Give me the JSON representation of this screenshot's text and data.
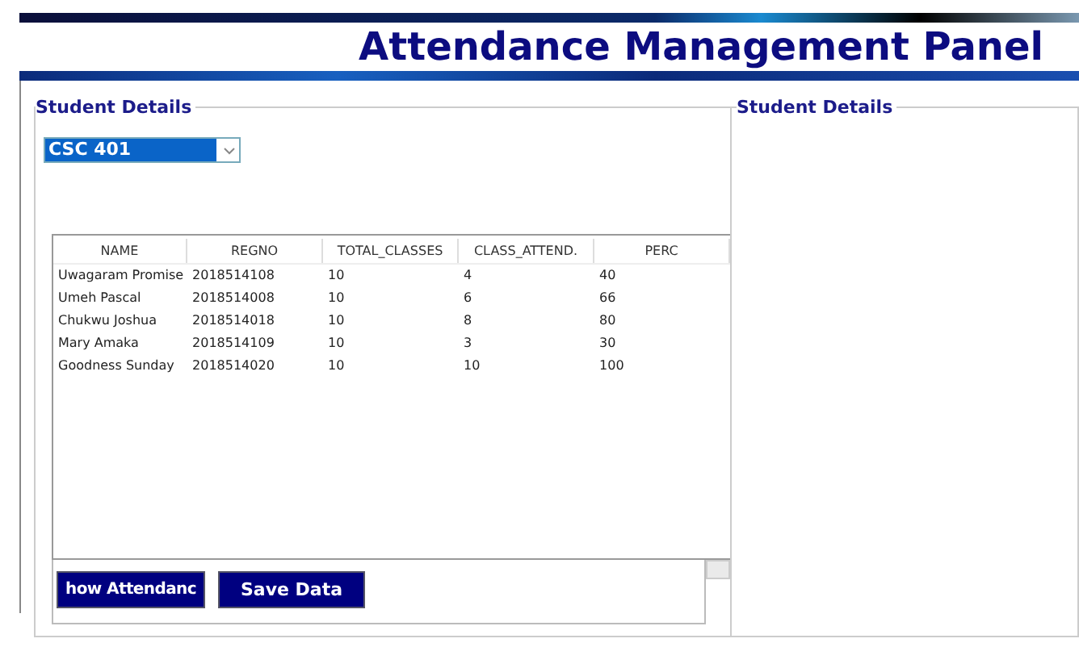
{
  "header": {
    "title": "Attendance Management Panel"
  },
  "left_group": {
    "title": "Student Details",
    "course_select": {
      "value": "CSC 401"
    },
    "table": {
      "columns": [
        "NAME",
        "REGNO",
        "TOTAL_CLASSES",
        "CLASS_ATTEND.",
        "PERC"
      ],
      "rows": [
        [
          "Uwagaram Promise",
          "2018514108",
          "10",
          "4",
          "40"
        ],
        [
          "Umeh Pascal",
          "2018514008",
          "10",
          "6",
          "66"
        ],
        [
          "Chukwu Joshua",
          "2018514018",
          "10",
          "8",
          "80"
        ],
        [
          "Mary Amaka",
          "2018514109",
          "10",
          "3",
          "30"
        ],
        [
          "Goodness Sunday",
          "2018514020",
          "10",
          "10",
          "100"
        ]
      ]
    },
    "buttons": [
      "how Attendanc",
      "Save Data"
    ]
  },
  "right_group": {
    "title": "Student Details"
  }
}
